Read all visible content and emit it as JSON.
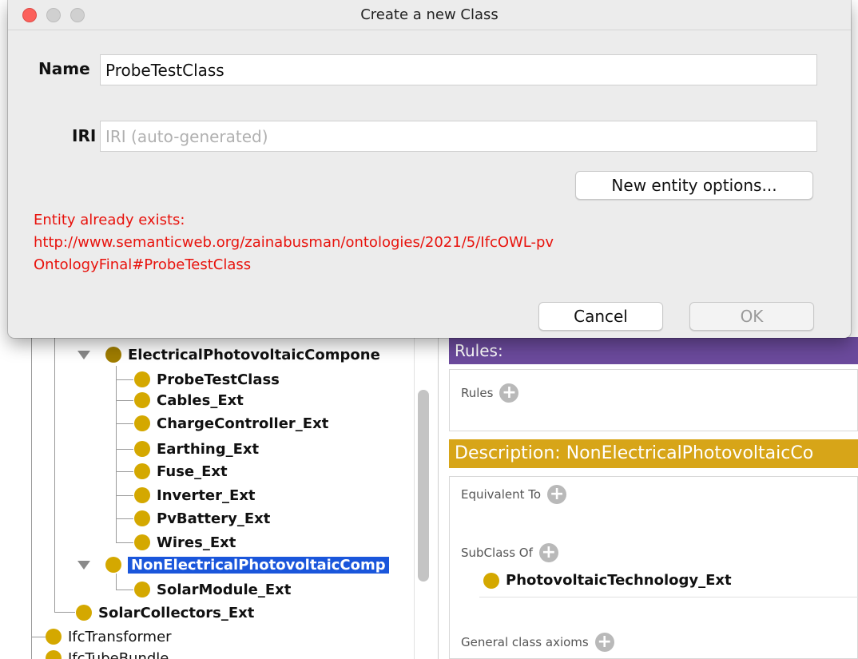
{
  "dialog": {
    "title": "Create a new Class",
    "name_label": "Name",
    "name_value": "ProbeTestClass",
    "iri_label": "IRI",
    "iri_placeholder": "IRI (auto-generated)",
    "new_entity_options_label": "New entity options...",
    "error_lines": [
      "Entity already exists:",
      "http://www.semanticweb.org/zainabusman/ontologies/2021/5/IfcOWL-pv",
      "OntologyFinal#ProbeTestClass"
    ],
    "cancel_label": "Cancel",
    "ok_label": "OK"
  },
  "tree": {
    "parent_label": "ElectricalPhotovoltaicCompone",
    "children": [
      "ProbeTestClass",
      "Cables_Ext",
      "ChargeController_Ext",
      "Earthing_Ext",
      "Fuse_Ext",
      "Inverter_Ext",
      "PvBattery_Ext",
      "Wires_Ext"
    ],
    "selected_label": "NonElectricalPhotovoltaicComp",
    "selected_child": "SolarModule_Ext",
    "sibling_label": "SolarCollectors_Ext",
    "root_items": [
      "IfcTransformer",
      "IfcTubeBundle"
    ]
  },
  "right": {
    "rules_header": "Rules:",
    "rules_label": "Rules",
    "description_header": "Description: NonElectricalPhotovoltaicCo",
    "equivalent_label": "Equivalent To",
    "subclass_label": "SubClass Of",
    "subclass_item": "PhotovoltaicTechnology_Ext",
    "general_axioms_label": "General class axioms"
  },
  "colors": {
    "error": "#e8120c",
    "selection": "#1a56db",
    "rules_header": "#6b4a9c",
    "description_header": "#d7a518",
    "class_dot": "#d4a800"
  }
}
